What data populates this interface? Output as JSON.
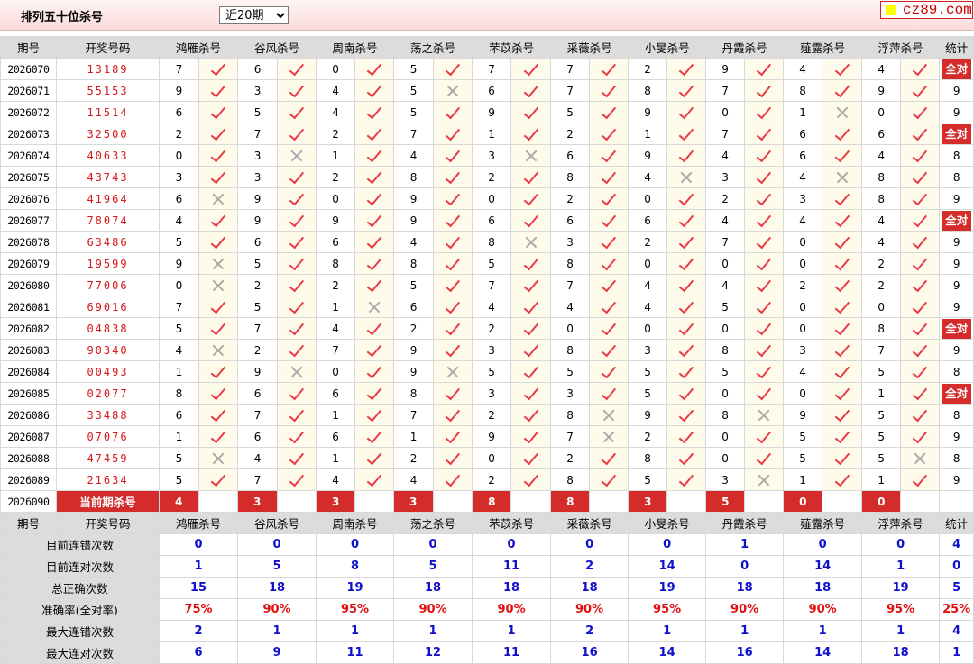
{
  "page": {
    "title": "排列五十位杀号",
    "period_select": "近20期",
    "logo_text": "cz89.com"
  },
  "headers": [
    "期号",
    "开奖号码",
    "鸿雁杀号",
    "谷风杀号",
    "周南杀号",
    "荡之杀号",
    "芣苡杀号",
    "采薇杀号",
    "小旻杀号",
    "丹霞杀号",
    "薤露杀号",
    "浮萍杀号",
    "统计"
  ],
  "rows": [
    {
      "issue": "2026070",
      "prize": "13189",
      "kills": [
        "7",
        "6",
        "0",
        "5",
        "7",
        "7",
        "2",
        "9",
        "4",
        "4"
      ],
      "ok": [
        1,
        1,
        1,
        1,
        1,
        1,
        1,
        1,
        1,
        1
      ],
      "stat": "全对"
    },
    {
      "issue": "2026071",
      "prize": "55153",
      "kills": [
        "9",
        "3",
        "4",
        "5",
        "6",
        "7",
        "8",
        "7",
        "8",
        "9"
      ],
      "ok": [
        1,
        1,
        1,
        0,
        1,
        1,
        1,
        1,
        1,
        1
      ],
      "stat": "9"
    },
    {
      "issue": "2026072",
      "prize": "11514",
      "kills": [
        "6",
        "5",
        "4",
        "5",
        "9",
        "5",
        "9",
        "0",
        "1",
        "0"
      ],
      "ok": [
        1,
        1,
        1,
        1,
        1,
        1,
        1,
        1,
        0,
        1
      ],
      "stat": "9"
    },
    {
      "issue": "2026073",
      "prize": "32500",
      "kills": [
        "2",
        "7",
        "2",
        "7",
        "1",
        "2",
        "1",
        "7",
        "6",
        "6"
      ],
      "ok": [
        1,
        1,
        1,
        1,
        1,
        1,
        1,
        1,
        1,
        1
      ],
      "stat": "全对"
    },
    {
      "issue": "2026074",
      "prize": "40633",
      "kills": [
        "0",
        "3",
        "1",
        "4",
        "3",
        "6",
        "9",
        "4",
        "6",
        "4"
      ],
      "ok": [
        1,
        0,
        1,
        1,
        0,
        1,
        1,
        1,
        1,
        1
      ],
      "stat": "8"
    },
    {
      "issue": "2026075",
      "prize": "43743",
      "kills": [
        "3",
        "3",
        "2",
        "8",
        "2",
        "8",
        "4",
        "3",
        "4",
        "8"
      ],
      "ok": [
        1,
        1,
        1,
        1,
        1,
        1,
        0,
        1,
        0,
        1
      ],
      "stat": "8"
    },
    {
      "issue": "2026076",
      "prize": "41964",
      "kills": [
        "6",
        "9",
        "0",
        "9",
        "0",
        "2",
        "0",
        "2",
        "3",
        "8"
      ],
      "ok": [
        0,
        1,
        1,
        1,
        1,
        1,
        1,
        1,
        1,
        1
      ],
      "stat": "9"
    },
    {
      "issue": "2026077",
      "prize": "78074",
      "kills": [
        "4",
        "9",
        "9",
        "9",
        "6",
        "6",
        "6",
        "4",
        "4",
        "4"
      ],
      "ok": [
        1,
        1,
        1,
        1,
        1,
        1,
        1,
        1,
        1,
        1
      ],
      "stat": "全对"
    },
    {
      "issue": "2026078",
      "prize": "63486",
      "kills": [
        "5",
        "6",
        "6",
        "4",
        "8",
        "3",
        "2",
        "7",
        "0",
        "4"
      ],
      "ok": [
        1,
        1,
        1,
        1,
        0,
        1,
        1,
        1,
        1,
        1
      ],
      "stat": "9"
    },
    {
      "issue": "2026079",
      "prize": "19599",
      "kills": [
        "9",
        "5",
        "8",
        "8",
        "5",
        "8",
        "0",
        "0",
        "0",
        "2"
      ],
      "ok": [
        0,
        1,
        1,
        1,
        1,
        1,
        1,
        1,
        1,
        1
      ],
      "stat": "9"
    },
    {
      "issue": "2026080",
      "prize": "77006",
      "kills": [
        "0",
        "2",
        "2",
        "5",
        "7",
        "7",
        "4",
        "4",
        "2",
        "2"
      ],
      "ok": [
        0,
        1,
        1,
        1,
        1,
        1,
        1,
        1,
        1,
        1
      ],
      "stat": "9"
    },
    {
      "issue": "2026081",
      "prize": "69016",
      "kills": [
        "7",
        "5",
        "1",
        "6",
        "4",
        "4",
        "4",
        "5",
        "0",
        "0"
      ],
      "ok": [
        1,
        1,
        0,
        1,
        1,
        1,
        1,
        1,
        1,
        1
      ],
      "stat": "9"
    },
    {
      "issue": "2026082",
      "prize": "04838",
      "kills": [
        "5",
        "7",
        "4",
        "2",
        "2",
        "0",
        "0",
        "0",
        "0",
        "8"
      ],
      "ok": [
        1,
        1,
        1,
        1,
        1,
        1,
        1,
        1,
        1,
        1
      ],
      "stat": "全对"
    },
    {
      "issue": "2026083",
      "prize": "90340",
      "kills": [
        "4",
        "2",
        "7",
        "9",
        "3",
        "8",
        "3",
        "8",
        "3",
        "7"
      ],
      "ok": [
        0,
        1,
        1,
        1,
        1,
        1,
        1,
        1,
        1,
        1
      ],
      "stat": "9"
    },
    {
      "issue": "2026084",
      "prize": "00493",
      "kills": [
        "1",
        "9",
        "0",
        "9",
        "5",
        "5",
        "5",
        "5",
        "4",
        "5"
      ],
      "ok": [
        1,
        0,
        1,
        0,
        1,
        1,
        1,
        1,
        1,
        1
      ],
      "stat": "8"
    },
    {
      "issue": "2026085",
      "prize": "02077",
      "kills": [
        "8",
        "6",
        "6",
        "8",
        "3",
        "3",
        "5",
        "0",
        "0",
        "1"
      ],
      "ok": [
        1,
        1,
        1,
        1,
        1,
        1,
        1,
        1,
        1,
        1
      ],
      "stat": "全对"
    },
    {
      "issue": "2026086",
      "prize": "33488",
      "kills": [
        "6",
        "7",
        "1",
        "7",
        "2",
        "8",
        "9",
        "8",
        "9",
        "5"
      ],
      "ok": [
        1,
        1,
        1,
        1,
        1,
        0,
        1,
        0,
        1,
        1
      ],
      "stat": "8"
    },
    {
      "issue": "2026087",
      "prize": "07076",
      "kills": [
        "1",
        "6",
        "6",
        "1",
        "9",
        "7",
        "2",
        "0",
        "5",
        "5"
      ],
      "ok": [
        1,
        1,
        1,
        1,
        1,
        0,
        1,
        1,
        1,
        1
      ],
      "stat": "9"
    },
    {
      "issue": "2026088",
      "prize": "47459",
      "kills": [
        "5",
        "4",
        "1",
        "2",
        "0",
        "2",
        "8",
        "0",
        "5",
        "5"
      ],
      "ok": [
        0,
        1,
        1,
        1,
        1,
        1,
        1,
        1,
        1,
        0
      ],
      "stat": "8"
    },
    {
      "issue": "2026089",
      "prize": "21634",
      "kills": [
        "5",
        "7",
        "4",
        "4",
        "2",
        "8",
        "5",
        "3",
        "1",
        "1"
      ],
      "ok": [
        1,
        1,
        1,
        1,
        1,
        1,
        1,
        0,
        1,
        1
      ],
      "stat": "9"
    }
  ],
  "current": {
    "issue": "2026090",
    "label": "当前期杀号",
    "kills": [
      "4",
      "3",
      "3",
      "3",
      "8",
      "8",
      "3",
      "5",
      "0",
      "0"
    ]
  },
  "stats": [
    {
      "label": "目前连错次数",
      "values": [
        "0",
        "0",
        "0",
        "0",
        "0",
        "0",
        "0",
        "1",
        "0",
        "0",
        "4"
      ]
    },
    {
      "label": "目前连对次数",
      "values": [
        "1",
        "5",
        "8",
        "5",
        "11",
        "2",
        "14",
        "0",
        "14",
        "1",
        "0"
      ]
    },
    {
      "label": "总正确次数",
      "values": [
        "15",
        "18",
        "19",
        "18",
        "18",
        "18",
        "19",
        "18",
        "18",
        "19",
        "5"
      ]
    },
    {
      "label": "准确率(全对率)",
      "values": [
        "75%",
        "90%",
        "95%",
        "90%",
        "90%",
        "90%",
        "95%",
        "90%",
        "90%",
        "95%",
        "25%"
      ],
      "red": true
    },
    {
      "label": "最大连错次数",
      "values": [
        "2",
        "1",
        "1",
        "1",
        "1",
        "2",
        "1",
        "1",
        "1",
        "1",
        "4"
      ]
    },
    {
      "label": "最大连对次数",
      "values": [
        "6",
        "9",
        "11",
        "12",
        "11",
        "16",
        "14",
        "16",
        "14",
        "18",
        "1"
      ]
    }
  ]
}
